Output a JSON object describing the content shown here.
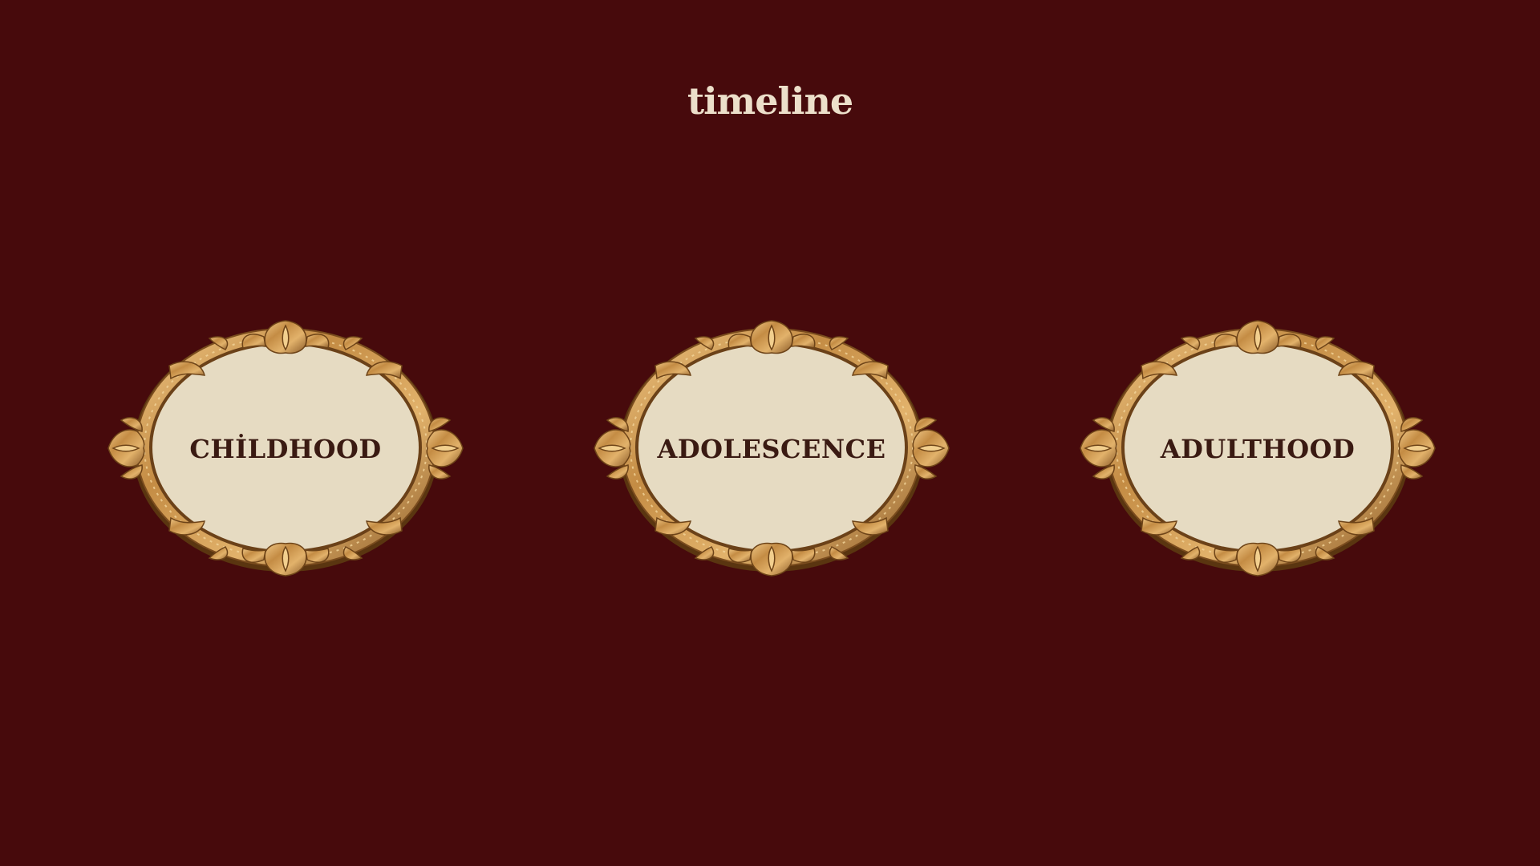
{
  "title": "timeline",
  "stages": [
    {
      "label": "CHİLDHOOD"
    },
    {
      "label": "ADOLESCENCE"
    },
    {
      "label": "ADULTHOOD"
    }
  ],
  "colors": {
    "background": "#470a0c",
    "title": "#ecdfca",
    "oval_fill": "#e6dbc2",
    "frame_gold": "#c89a55",
    "label": "#3a1a12"
  }
}
